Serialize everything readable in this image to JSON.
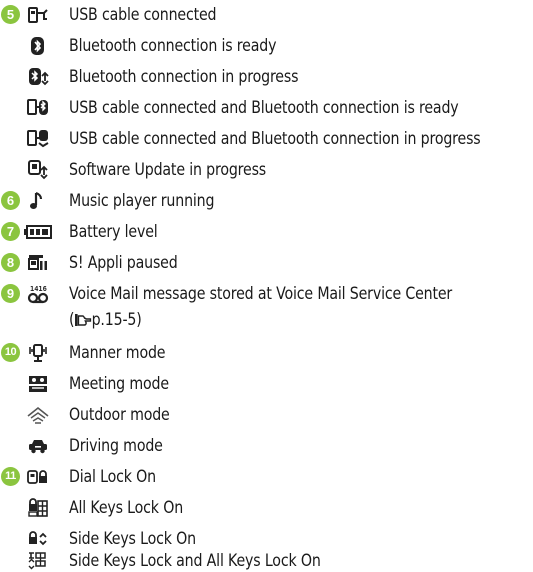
{
  "items": [
    {
      "number": "5",
      "icon": "usb-connected-icon",
      "text": "USB cable connected"
    },
    {
      "number": "",
      "icon": "bluetooth-ready-icon",
      "text": "Bluetooth connection is ready"
    },
    {
      "number": "",
      "icon": "bluetooth-progress-icon",
      "text": "Bluetooth connection in progress"
    },
    {
      "number": "",
      "icon": "usb-bluetooth-ready-icon",
      "text": "USB cable connected and Bluetooth connection is ready"
    },
    {
      "number": "",
      "icon": "usb-bluetooth-progress-icon",
      "text": "USB cable connected and Bluetooth connection in progress"
    },
    {
      "number": "",
      "icon": "software-update-icon",
      "text": "Software Update in progress"
    },
    {
      "number": "6",
      "icon": "music-note-icon",
      "text": "Music player running"
    },
    {
      "number": "7",
      "icon": "battery-icon",
      "text": "Battery level"
    },
    {
      "number": "8",
      "icon": "appli-paused-icon",
      "text": "S! Appli paused"
    },
    {
      "number": "9",
      "icon": "voicemail-icon",
      "text": "Voice Mail message stored at Voice Mail Service Center"
    },
    {
      "number": "10",
      "icon": "manner-mode-icon",
      "text": "Manner mode"
    },
    {
      "number": "",
      "icon": "meeting-mode-icon",
      "text": "Meeting mode"
    },
    {
      "number": "",
      "icon": "outdoor-mode-icon",
      "text": "Outdoor mode"
    },
    {
      "number": "",
      "icon": "driving-mode-icon",
      "text": "Driving mode"
    },
    {
      "number": "11",
      "icon": "dial-lock-icon",
      "text": "Dial Lock On"
    },
    {
      "number": "",
      "icon": "all-keys-lock-icon",
      "text": "All Keys Lock On"
    },
    {
      "number": "",
      "icon": "side-keys-lock-icon",
      "text": "Side Keys Lock On"
    },
    {
      "number": "",
      "icon": "side-all-keys-lock-icon",
      "text": "Side Keys Lock and All Keys Lock On"
    }
  ],
  "voicemail_ref": {
    "open": "(",
    "pointer_icon": "pointing-hand-icon",
    "page": "p.15-5",
    "close": ")"
  },
  "colors": {
    "badge": "#8bc53f",
    "text": "#1a1a1a"
  }
}
